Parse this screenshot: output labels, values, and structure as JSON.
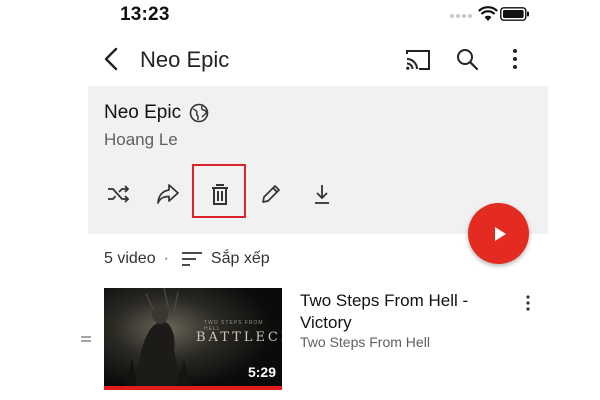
{
  "status_bar": {
    "time": "13:23"
  },
  "app_bar": {
    "title": "Neo Epic"
  },
  "playlist": {
    "title": "Neo Epic",
    "owner": "Hoang Le",
    "video_count": "5 video",
    "separator": "·",
    "sort_label": "Sắp xếp"
  },
  "videos": [
    {
      "title": "Two Steps From Hell - Victory",
      "channel": "Two Steps From Hell",
      "duration": "5:29",
      "thumbnail_text": "BATTLECRY",
      "thumbnail_subtext": "TWO STEPS FROM HELL"
    }
  ],
  "colors": {
    "accent": "#e32b22",
    "highlight_box": "#d9252a",
    "header_bg": "#f1f1f1",
    "progress": "#e21b1b"
  },
  "icons": {
    "status": [
      "wifi-icon",
      "battery-icon"
    ],
    "app_bar": [
      "back-icon",
      "cast-icon",
      "search-icon",
      "more-icon"
    ],
    "actions": [
      "shuffle-icon",
      "share-icon",
      "trash-icon",
      "pencil-icon",
      "download-icon"
    ],
    "fab": "play-icon"
  }
}
